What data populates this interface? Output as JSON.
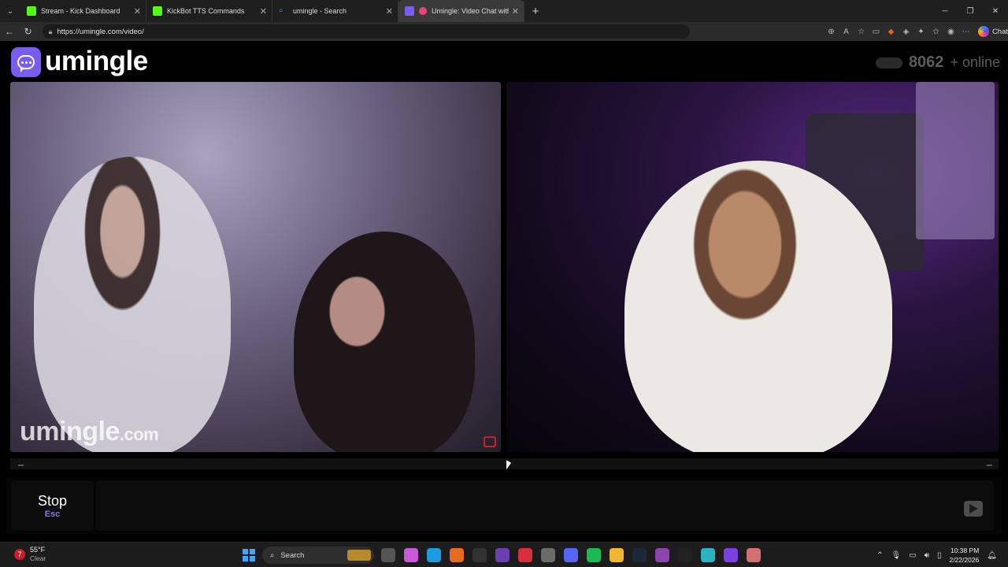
{
  "browser": {
    "tabs": [
      {
        "title": "Stream - Kick Dashboard",
        "favicon_color": "#53fc18",
        "active": false
      },
      {
        "title": "KickBot TTS Commands",
        "favicon_color": "#53fc18",
        "active": false
      },
      {
        "title": "umingle - Search",
        "favicon_color": "#4a8cff",
        "active": false
      },
      {
        "title": "Umingle: Video Chat with Str",
        "favicon_color": "#7b5cf0",
        "active": true
      }
    ],
    "new_tab_label": "+",
    "url": "https://umingle.com/video/",
    "chat_label": "Chat"
  },
  "site": {
    "logo_text": "umingle",
    "online_count": "8062",
    "online_suffix": "+ online"
  },
  "video": {
    "watermark_main": "umingle",
    "watermark_suffix": ".com"
  },
  "controls": {
    "stop_label": "Stop",
    "stop_shortcut": "Esc",
    "chat_placeholder": ""
  },
  "taskbar": {
    "temperature": "55°F",
    "condition": "Clear",
    "weather_badge": "7",
    "search_label": "Search",
    "time": "10:38 PM",
    "date": "2/22/2026"
  },
  "colors": {
    "brand": "#7b5cf0",
    "stop_shortcut": "#8a78f0"
  }
}
